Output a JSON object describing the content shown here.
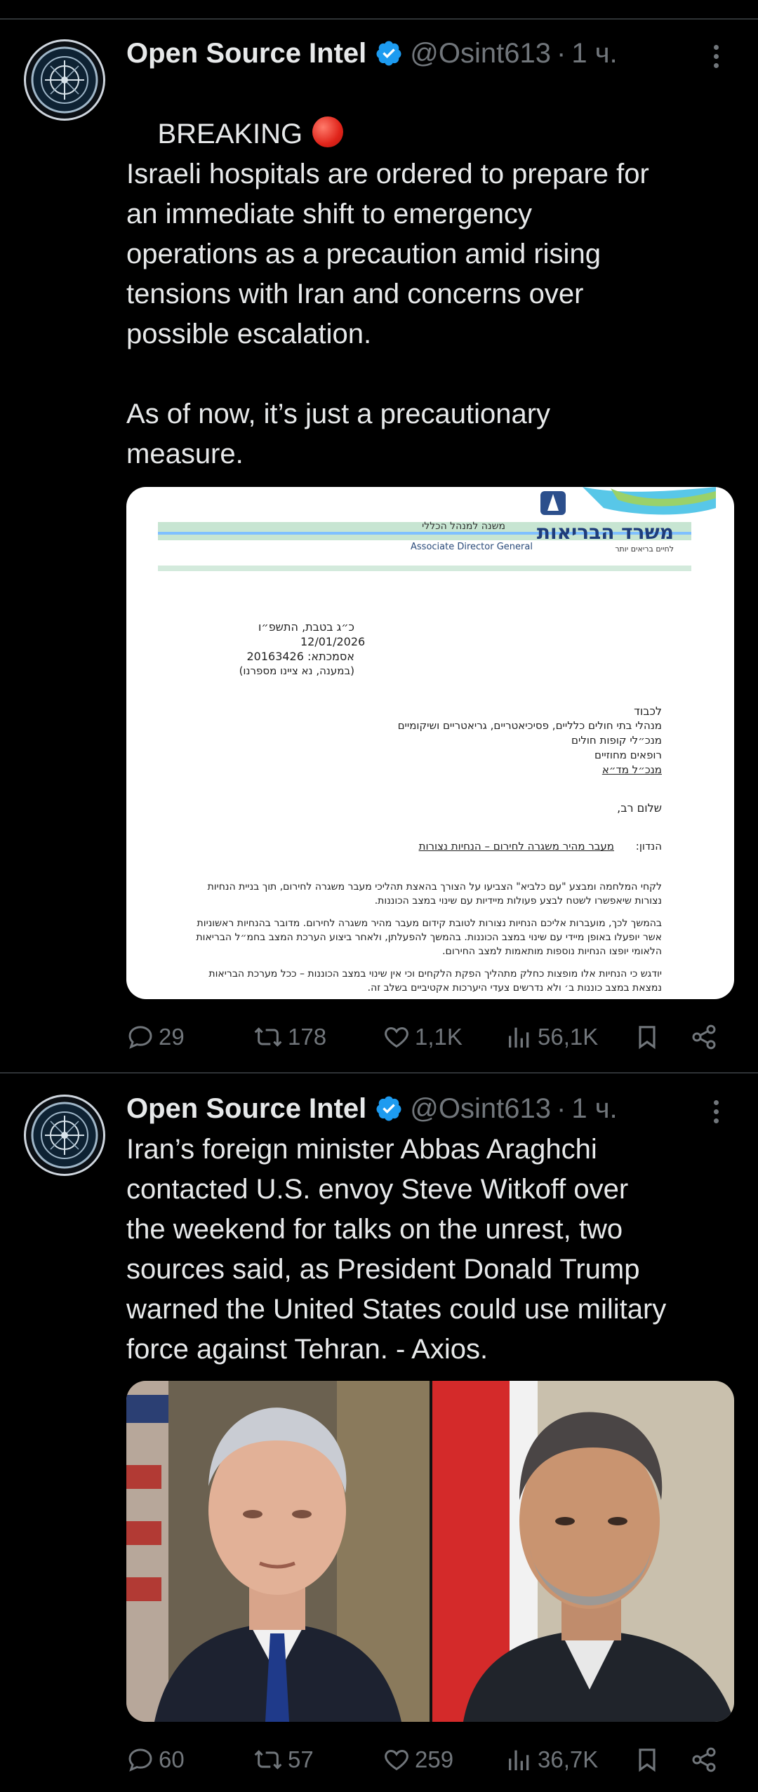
{
  "tweets": [
    {
      "author": "Open Source Intel",
      "handle": "@Osint613",
      "separator": "·",
      "time": "1 ч.",
      "first_line": "BREAKING",
      "text": "Israeli hospitals are ordered to prepare for\nan immediate shift to emergency\noperations as a precaution amid rising\ntensions with Iran and concerns over\npossible escalation.\n\nAs of now, it’s just a precautionary\nmeasure.",
      "document": {
        "ministry_name": "משרד הבריאות",
        "ministry_tagline": "לחיים בריאים יותר",
        "office_hebrew": "משנה למנהל הכללי",
        "office_english": "Associate Director General",
        "hebrew_date": "כ״ג בטבת, התשפ״ו",
        "date": "12/01/2026",
        "reference": "אסמכתא: 20163426",
        "reference_note": "(במענה, נא ציינו מספרנו)",
        "to_label": "לכבוד",
        "recipients": [
          "מנהלי בתי חולים כלליים, פסיכיאטריים, גריאטריים ושיקומיים",
          "מנכ״לי קופות חולים",
          "רופאים מחוזיים",
          "מנכ״ל מד״א"
        ],
        "greeting": "שלום רב,",
        "subject_label": "הנדון:",
        "subject": "מעבר מהיר משגרה לחירום – הנחיות נצורות",
        "paragraphs": [
          "לקחי המלחמה ומבצע \"עם כלביא\" הצביעו על הצורך בהאצת תהליכי מעבר משגרה לחירום, תוך בניית הנחיות נצורות שיאפשרו לשטח לבצע פעולות מיידיות עם שינוי במצב הכוננות.",
          "בהמשך לכך, מועברות אליכם הנחיות נצורות לטובת קידום מעבר מהיר משגרה לחירום. מדובר בהנחיות ראשוניות אשר יופעלו באופן מיידי עם שינוי במצב הכוננות. בהמשך להפעלתן, ולאחר ביצוע הערכת המצב בחמ״ל הבריאות הלאומי יופצו הנחיות נוספות מותאמות למצב החירום.",
          "יודגש כי הנחיות אלו מופצות כחלק מתהליך הפקת הלקחים וכי אין שינוי במצב הכוננות – ככל מערכת הבריאות נמצאת במצב כוננות ב׳ ולא נדרשים צעדי היערכות אקטיביים בשלב זה."
        ]
      },
      "stats": {
        "replies": "29",
        "reposts": "178",
        "likes": "1,1K",
        "views": "56,1K"
      }
    },
    {
      "author": "Open Source Intel",
      "handle": "@Osint613",
      "separator": "·",
      "time": "1 ч.",
      "text": "Iran’s foreign minister Abbas Araghchi\ncontacted U.S. envoy Steve Witkoff over\nthe weekend for talks on the unrest, two\nsources said, as President Donald Trump\nwarned the United States could use military\nforce against Tehran. - Axios.",
      "stats": {
        "replies": "60",
        "reposts": "57",
        "likes": "259",
        "views": "36,7K"
      }
    }
  ],
  "colors": {
    "background": "#000000",
    "text": "#e7e9ea",
    "muted": "#71767b",
    "verified": "#1d9bf0",
    "divider": "#2f3336"
  }
}
